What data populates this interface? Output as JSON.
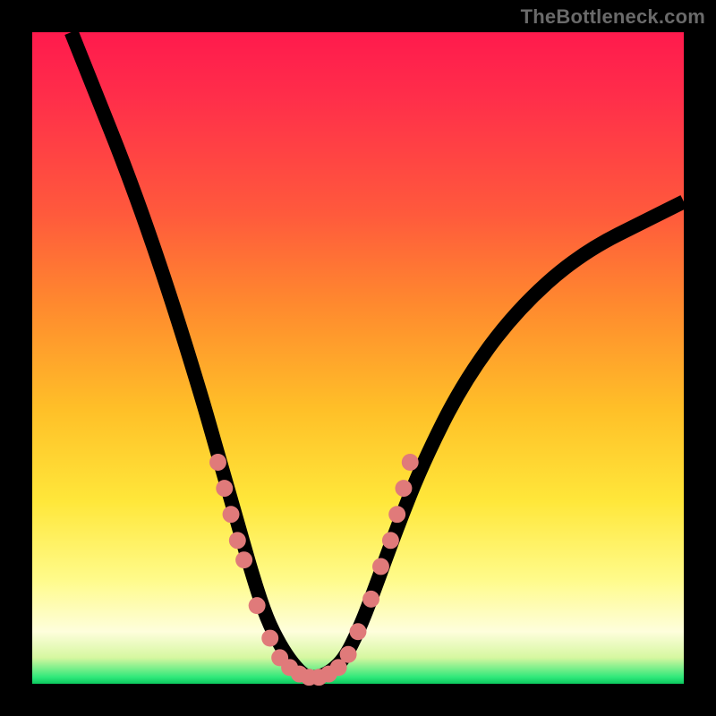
{
  "watermark": "TheBottleneck.com",
  "colors": {
    "gradient_top": "#ff1a4d",
    "gradient_mid": "#ffe73a",
    "gradient_bottom": "#0cc95e",
    "curve": "#000000",
    "dots": "#e07a7a",
    "frame": "#000000"
  },
  "chart_data": {
    "type": "line",
    "title": "",
    "xlabel": "",
    "ylabel": "",
    "xlim": [
      0,
      100
    ],
    "ylim": [
      0,
      100
    ],
    "grid": false,
    "legend": false,
    "series": [
      {
        "name": "bottleneck-curve",
        "x": [
          6,
          10,
          14,
          18,
          22,
          26,
          28,
          30,
          32,
          34,
          36,
          38,
          40,
          42,
          44,
          46,
          48,
          50,
          52,
          56,
          60,
          66,
          74,
          84,
          96,
          100
        ],
        "y": [
          100,
          90,
          80,
          69,
          57,
          44,
          37,
          30,
          23,
          16,
          10,
          6,
          3,
          1,
          1,
          2,
          4,
          8,
          13,
          24,
          34,
          46,
          57,
          66,
          72,
          74
        ]
      }
    ],
    "markers": [
      {
        "x": 28.5,
        "y": 34
      },
      {
        "x": 29.5,
        "y": 30
      },
      {
        "x": 30.5,
        "y": 26
      },
      {
        "x": 31.5,
        "y": 22
      },
      {
        "x": 32.5,
        "y": 19
      },
      {
        "x": 34.5,
        "y": 12
      },
      {
        "x": 36.5,
        "y": 7
      },
      {
        "x": 38.0,
        "y": 4
      },
      {
        "x": 39.5,
        "y": 2.5
      },
      {
        "x": 41.0,
        "y": 1.5
      },
      {
        "x": 42.5,
        "y": 1
      },
      {
        "x": 44.0,
        "y": 1
      },
      {
        "x": 45.5,
        "y": 1.5
      },
      {
        "x": 47.0,
        "y": 2.5
      },
      {
        "x": 48.5,
        "y": 4.5
      },
      {
        "x": 50.0,
        "y": 8
      },
      {
        "x": 52.0,
        "y": 13
      },
      {
        "x": 53.5,
        "y": 18
      },
      {
        "x": 55.0,
        "y": 22
      },
      {
        "x": 56.0,
        "y": 26
      },
      {
        "x": 57.0,
        "y": 30
      },
      {
        "x": 58.0,
        "y": 34
      }
    ]
  }
}
